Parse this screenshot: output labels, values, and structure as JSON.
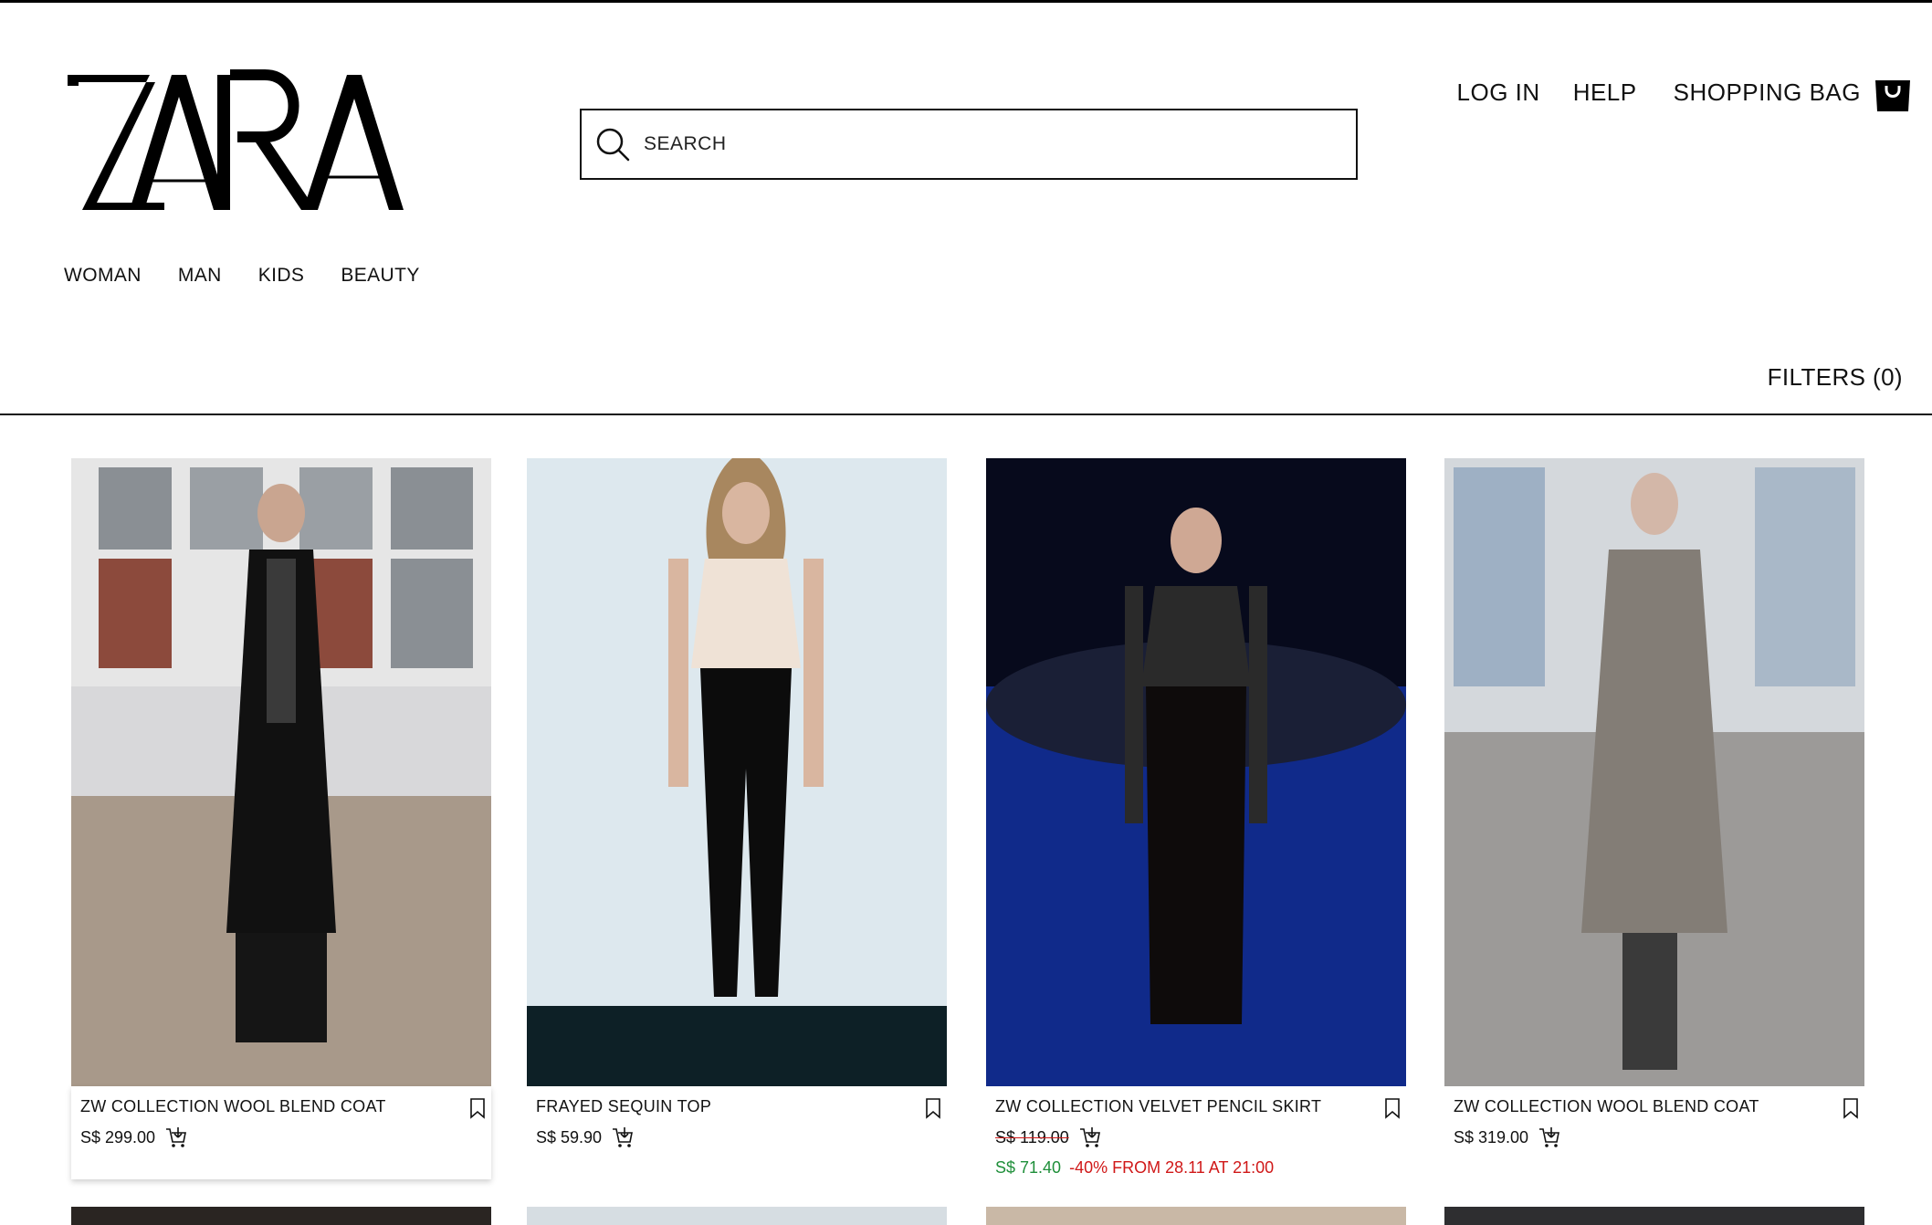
{
  "brand": {
    "logo_text": "ZARA"
  },
  "search": {
    "placeholder": "SEARCH"
  },
  "top_nav": {
    "login": "LOG IN",
    "help": "HELP",
    "shopping_bag": "SHOPPING BAG"
  },
  "categories": [
    "WOMAN",
    "MAN",
    "KIDS",
    "BEAUTY"
  ],
  "filters": {
    "label": "FILTERS (0)"
  },
  "products": [
    {
      "name": "ZW COLLECTION WOOL BLEND COAT",
      "price": "S$ 299.00"
    },
    {
      "name": "FRAYED SEQUIN TOP",
      "price": "S$ 59.90"
    },
    {
      "name": "ZW COLLECTION VELVET PENCIL SKIRT",
      "price": "S$ 119.00",
      "sale_price": "S$ 71.40",
      "discount": "-40% FROM 28.11 AT 21:00"
    },
    {
      "name": "ZW COLLECTION WOOL BLEND COAT",
      "price": "S$ 319.00"
    }
  ],
  "colors": {
    "text": "#111111",
    "sale_green": "#1f8f3a",
    "sale_red": "#d01818"
  }
}
